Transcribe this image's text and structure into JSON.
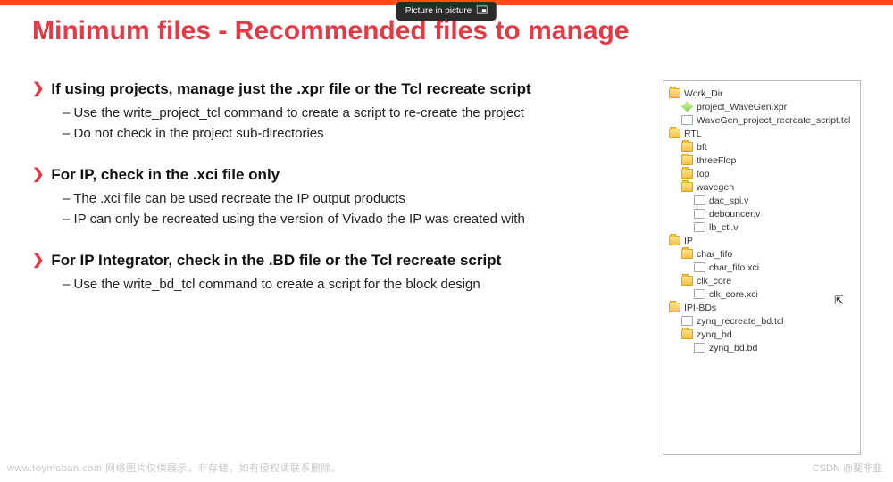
{
  "pip": {
    "label": "Picture in picture"
  },
  "title": "Minimum files - Recommended files to manage",
  "sections": [
    {
      "head": "If using projects, manage just the .xpr file or the Tcl recreate script",
      "subs": [
        "Use the write_project_tcl command to create a script to re-create the project",
        "Do not check in the project sub-directories"
      ]
    },
    {
      "head": "For IP, check in the .xci file only",
      "subs": [
        "The .xci file can be used recreate the IP output products",
        "IP can only be recreated using the version of Vivado the IP was created with"
      ]
    },
    {
      "head": "For IP Integrator, check in the .BD file or the Tcl recreate script",
      "subs": [
        "Use the write_bd_tcl command to create a script for the block design"
      ]
    }
  ],
  "tree": [
    {
      "depth": 0,
      "icon": "folder",
      "label": "Work_Dir"
    },
    {
      "depth": 1,
      "icon": "xpr",
      "label": "project_WaveGen.xpr"
    },
    {
      "depth": 1,
      "icon": "file",
      "label": "WaveGen_project_recreate_script.tcl"
    },
    {
      "depth": 0,
      "icon": "folder",
      "label": "RTL"
    },
    {
      "depth": 1,
      "icon": "folder",
      "label": "bft"
    },
    {
      "depth": 1,
      "icon": "folder",
      "label": "threeFlop"
    },
    {
      "depth": 1,
      "icon": "folder",
      "label": "top"
    },
    {
      "depth": 1,
      "icon": "folder",
      "label": "wavegen"
    },
    {
      "depth": 2,
      "icon": "file",
      "label": "dac_spi.v"
    },
    {
      "depth": 2,
      "icon": "file",
      "label": "debouncer.v"
    },
    {
      "depth": 2,
      "icon": "file",
      "label": "lb_ctl.v"
    },
    {
      "depth": 0,
      "icon": "folder",
      "label": "IP"
    },
    {
      "depth": 1,
      "icon": "folder",
      "label": "char_fifo"
    },
    {
      "depth": 2,
      "icon": "file",
      "label": "char_fifo.xci"
    },
    {
      "depth": 1,
      "icon": "folder",
      "label": "clk_core"
    },
    {
      "depth": 2,
      "icon": "file",
      "label": "clk_core.xci"
    },
    {
      "depth": 0,
      "icon": "folder",
      "label": "IPI-BDs"
    },
    {
      "depth": 1,
      "icon": "file",
      "label": "zynq_recreate_bd.tcl"
    },
    {
      "depth": 1,
      "icon": "folder",
      "label": "zynq_bd"
    },
    {
      "depth": 2,
      "icon": "file",
      "label": "zynq_bd.bd"
    }
  ],
  "footer": {
    "left": "www.toymoban.com 网络图片仅供展示，非存储，如有侵权请联系删除。",
    "right": "CSDN @斐非韭"
  }
}
